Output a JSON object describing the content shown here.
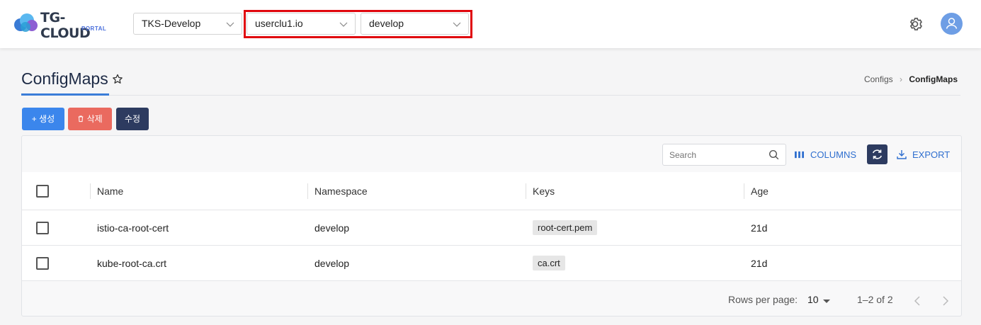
{
  "brand": {
    "name": "TG-CLOUD",
    "sub": "PORTAL"
  },
  "header": {
    "cluster_select": "TKS-Develop",
    "context_select": "userclu1.io",
    "namespace_select": "develop",
    "icons": [
      "gear-icon",
      "user-avatar-icon"
    ]
  },
  "page": {
    "title": "ConfigMaps",
    "breadcrumb": {
      "parent": "Configs",
      "current": "ConfigMaps"
    }
  },
  "actions": {
    "create": "생성",
    "delete": "삭제",
    "edit": "수정"
  },
  "toolbar": {
    "search_placeholder": "Search",
    "columns": "COLUMNS",
    "export": "EXPORT"
  },
  "table": {
    "columns": [
      "Name",
      "Namespace",
      "Keys",
      "Age"
    ],
    "rows": [
      {
        "name": "istio-ca-root-cert",
        "namespace": "develop",
        "keys": "root-cert.pem",
        "age": "21d"
      },
      {
        "name": "kube-root-ca.crt",
        "namespace": "develop",
        "keys": "ca.crt",
        "age": "21d"
      }
    ]
  },
  "pagination": {
    "rows_per_page_label": "Rows per page:",
    "rows_per_page": "10",
    "range": "1–2 of 2"
  },
  "colors": {
    "accent": "#3b86ec",
    "delete": "#ea6a5f",
    "dark": "#2d3b60",
    "highlight": "#e0070e"
  }
}
